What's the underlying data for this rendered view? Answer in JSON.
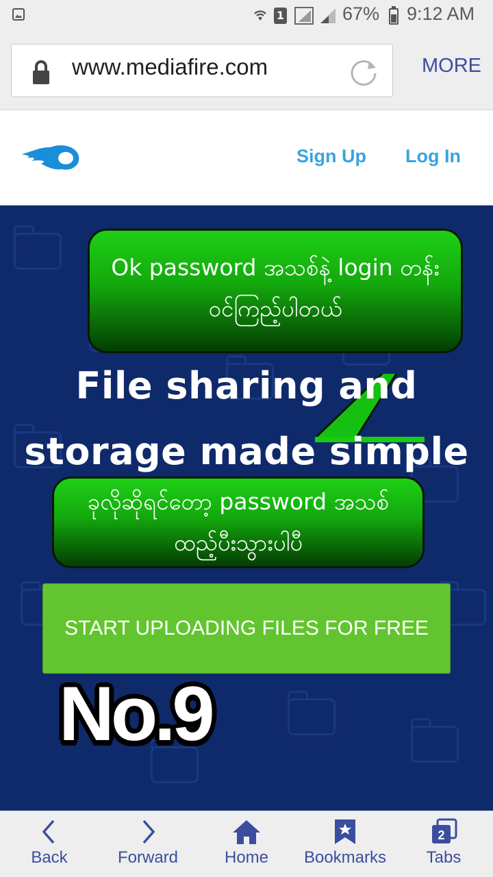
{
  "status_bar": {
    "battery_percent": "67%",
    "time": "9:12 AM",
    "sim_slot": "1",
    "icons": [
      "gallery-icon",
      "wifi-icon",
      "sim-icon",
      "signal-icon",
      "battery-icon"
    ]
  },
  "browser": {
    "url": "www.mediafire.com",
    "more_label": "MORE",
    "icons": [
      "lock-icon",
      "reload-icon"
    ]
  },
  "site": {
    "sign_up": "Sign Up",
    "log_in": "Log In",
    "heading_line1": "File sharing and",
    "heading_line2": "storage made simple",
    "cta_label": "START UPLOADING FILES FOR FREE",
    "brand_color": "#3aa3df",
    "hero_bg": "#0f2a6b",
    "cta_color": "#62c530"
  },
  "annotations": {
    "bubble1_line1": "Ok password အသစ်နဲ့ login တန်း",
    "bubble1_line2": "ဝင်ကြည့်ပါတယ်",
    "bubble2_line1": "ခုလိုဆိုရင်တော့ password အသစ်",
    "bubble2_line2": "ထည့်ပီးသွားပါပီ",
    "step_label": "No.9"
  },
  "bottom_nav": {
    "items": [
      {
        "label": "Back",
        "icon": "chevron-left-icon"
      },
      {
        "label": "Forward",
        "icon": "chevron-right-icon"
      },
      {
        "label": "Home",
        "icon": "home-icon"
      },
      {
        "label": "Bookmarks",
        "icon": "bookmark-icon"
      },
      {
        "label": "Tabs",
        "icon": "tabs-icon",
        "count": "2"
      }
    ],
    "color": "#3b4d9e"
  }
}
